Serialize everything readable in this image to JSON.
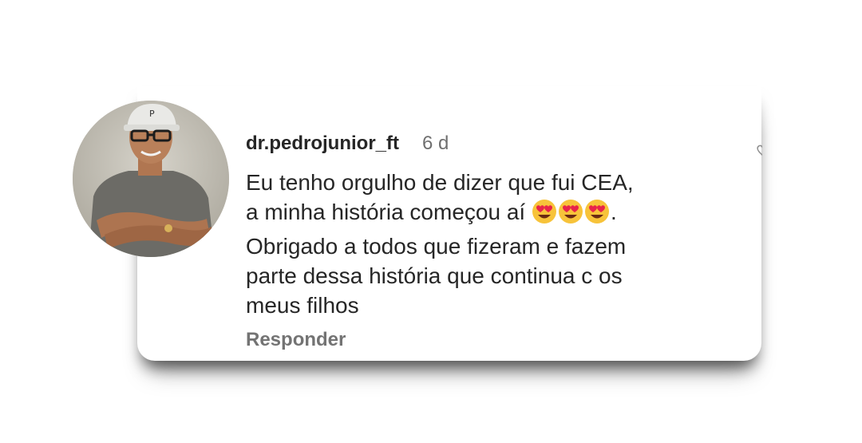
{
  "comment": {
    "username": "dr.pedrojunior_ft",
    "time": "6 d",
    "lines": [
      "Eu tenho orgulho de dizer que fui CEA,",
      "a minha história começou aí",
      "Obrigado a todos que fizeram e fazem",
      "parte dessa história que continua c os",
      "meus filhos"
    ],
    "line2_suffix": ".",
    "emojis": [
      "smiling-face-with-heart-eyes",
      "smiling-face-with-heart-eyes",
      "smiling-face-with-heart-eyes"
    ],
    "reply_label": "Responder"
  },
  "colors": {
    "text": "#262626",
    "secondary": "#737373",
    "emoji_face": "#f7c33a",
    "emoji_heart": "#e8244a"
  }
}
